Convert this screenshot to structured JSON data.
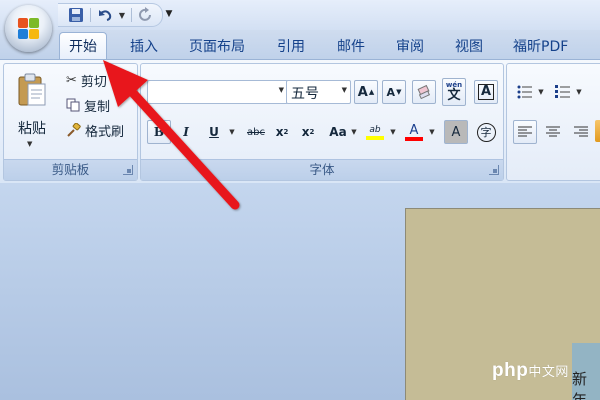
{
  "titlebar": {
    "qat": [
      {
        "name": "save-icon"
      },
      {
        "name": "undo-icon"
      },
      {
        "name": "redo-icon"
      }
    ]
  },
  "tabs": [
    {
      "label": "开始",
      "active": true
    },
    {
      "label": "插入"
    },
    {
      "label": "页面布局"
    },
    {
      "label": "引用"
    },
    {
      "label": "邮件"
    },
    {
      "label": "审阅"
    },
    {
      "label": "视图"
    },
    {
      "label": "福昕PDF"
    }
  ],
  "clipboard": {
    "paste_label": "粘贴",
    "cut_label": "剪切",
    "copy_label": "复制",
    "format_painter_label": "格式刷",
    "group_label": "剪贴板"
  },
  "font": {
    "font_name": "",
    "font_size": "五号",
    "grow_label": "A",
    "shrink_label": "A",
    "phonetic_label": "wén",
    "phonetic_char": "文",
    "charborder_label": "A",
    "bold": "B",
    "italic": "I",
    "underline": "U",
    "strike": "abc",
    "subscript": "x",
    "subscript_mark": "2",
    "superscript": "x",
    "superscript_mark": "2",
    "changecase": "Aa",
    "highlight": "ab",
    "fontcolor": "A",
    "charshade": "A",
    "enclose": "字",
    "group_label": "字体"
  },
  "document": {
    "visible_text": "新年"
  },
  "watermark": {
    "text": "php",
    "suffix": "中文网"
  },
  "colors": {
    "highlight": "#ffff00",
    "font_color": "#ff0000",
    "arrow": "#e8191a"
  }
}
